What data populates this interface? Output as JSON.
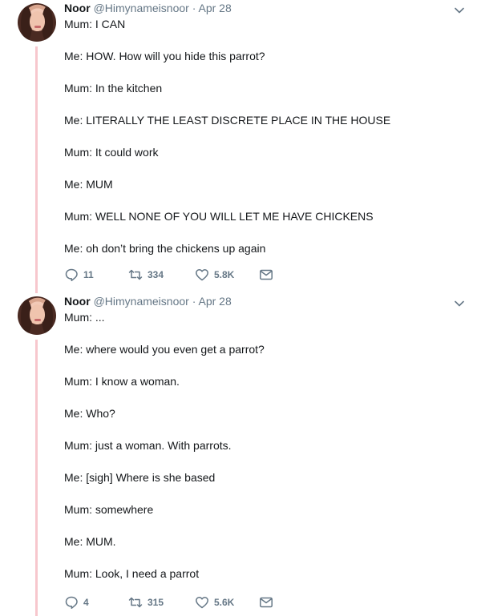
{
  "tweets": [
    {
      "author_name": "Noor",
      "handle": "@Himynameisnoor",
      "separator": "·",
      "date": "Apr 28",
      "lines": [
        "Mum: I CAN",
        "Me: HOW. How will you hide this parrot?",
        "Mum: In the kitchen",
        "Me: LITERALLY THE LEAST DISCRETE PLACE IN THE HOUSE",
        "Mum: It could work",
        "Me: MUM",
        "Mum: WELL NONE OF YOU WILL LET ME HAVE CHICKENS",
        "Me: oh don’t bring the chickens up again"
      ],
      "replies": "11",
      "retweets": "334",
      "likes": "5.8K"
    },
    {
      "author_name": "Noor",
      "handle": "@Himynameisnoor",
      "separator": "·",
      "date": "Apr 28",
      "lines": [
        "Mum: ...",
        "Me: where would you even get a parrot?",
        "Mum: I know a woman.",
        "Me: Who?",
        "Mum: just a woman. With parrots.",
        "Me: [sigh] Where is she based",
        "Mum: somewhere",
        "Me: MUM.",
        "Mum: Look, I need a parrot"
      ],
      "replies": "4",
      "retweets": "315",
      "likes": "5.6K"
    }
  ],
  "icons": {
    "reply": "reply-icon",
    "retweet": "retweet-icon",
    "like": "heart-icon",
    "dm": "envelope-icon",
    "menu": "chevron-down-icon",
    "avatar": "avatar"
  },
  "colors": {
    "thread_line": "#f7c7cd",
    "secondary_text": "#657786",
    "primary_text": "#14171a"
  }
}
